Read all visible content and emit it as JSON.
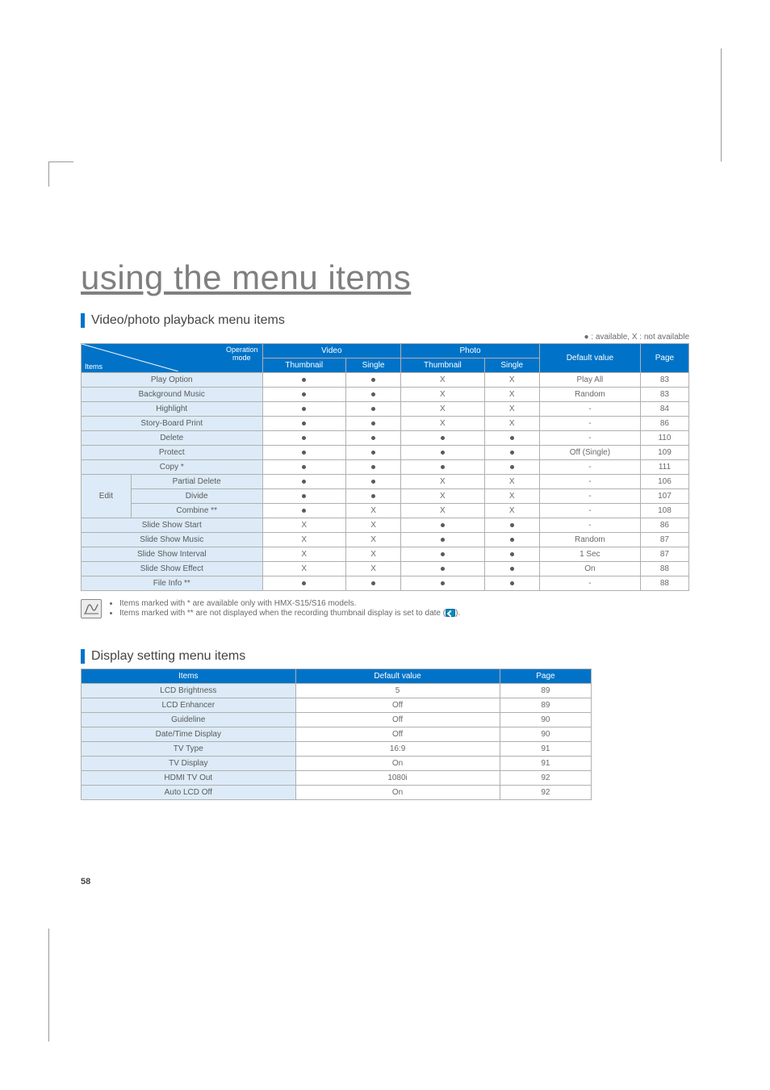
{
  "page_number": "58",
  "title": "using the menu items",
  "section1_heading": "Video/photo playback menu items",
  "legend": "● : available, X : not available",
  "t1_header": {
    "operation": "Operation",
    "mode": "mode",
    "items": "Items",
    "video": "Video",
    "photo": "Photo",
    "thumb": "Thumbnail",
    "single": "Single",
    "default": "Default value",
    "page": "Page"
  },
  "t1_rows": [
    {
      "item": "Play Option",
      "vthumb": "●",
      "vsingle": "●",
      "pthumb": "X",
      "psingle": "X",
      "def": "Play All",
      "page": "83"
    },
    {
      "item": "Background Music",
      "vthumb": "●",
      "vsingle": "●",
      "pthumb": "X",
      "psingle": "X",
      "def": "Random",
      "page": "83"
    },
    {
      "item": "Highlight",
      "vthumb": "●",
      "vsingle": "●",
      "pthumb": "X",
      "psingle": "X",
      "def": "-",
      "page": "84"
    },
    {
      "item": "Story-Board Print",
      "vthumb": "●",
      "vsingle": "●",
      "pthumb": "X",
      "psingle": "X",
      "def": "-",
      "page": "86"
    },
    {
      "item": "Delete",
      "vthumb": "●",
      "vsingle": "●",
      "pthumb": "●",
      "psingle": "●",
      "def": "-",
      "page": "110"
    },
    {
      "item": "Protect",
      "vthumb": "●",
      "vsingle": "●",
      "pthumb": "●",
      "psingle": "●",
      "def": "Off (Single)",
      "page": "109"
    },
    {
      "item": "Copy *",
      "vthumb": "●",
      "vsingle": "●",
      "pthumb": "●",
      "psingle": "●",
      "def": "-",
      "page": "111"
    }
  ],
  "edit_group_label": "Edit",
  "edit_rows": [
    {
      "item": "Partial Delete",
      "vthumb": "●",
      "vsingle": "●",
      "pthumb": "X",
      "psingle": "X",
      "def": "-",
      "page": "106"
    },
    {
      "item": "Divide",
      "vthumb": "●",
      "vsingle": "●",
      "pthumb": "X",
      "psingle": "X",
      "def": "-",
      "page": "107"
    },
    {
      "item": "Combine **",
      "vthumb": "●",
      "vsingle": "X",
      "pthumb": "X",
      "psingle": "X",
      "def": "-",
      "page": "108"
    }
  ],
  "t1_rows2": [
    {
      "item": "Slide Show Start",
      "vthumb": "X",
      "vsingle": "X",
      "pthumb": "●",
      "psingle": "●",
      "def": "-",
      "page": "86"
    },
    {
      "item": "Slide Show Music",
      "vthumb": "X",
      "vsingle": "X",
      "pthumb": "●",
      "psingle": "●",
      "def": "Random",
      "page": "87"
    },
    {
      "item": "Slide Show Interval",
      "vthumb": "X",
      "vsingle": "X",
      "pthumb": "●",
      "psingle": "●",
      "def": "1 Sec",
      "page": "87"
    },
    {
      "item": "Slide Show Effect",
      "vthumb": "X",
      "vsingle": "X",
      "pthumb": "●",
      "psingle": "●",
      "def": "On",
      "page": "88"
    },
    {
      "item": "File Info **",
      "vthumb": "●",
      "vsingle": "●",
      "pthumb": "●",
      "psingle": "●",
      "def": "-",
      "page": "88"
    }
  ],
  "notes": [
    "Items marked with * are available only with HMX-S15/S16 models.",
    "Items marked with ** are not displayed when the recording thumbnail display is set to date ("
  ],
  "note_tail": ").",
  "section2_heading": "Display setting menu items",
  "t2_header": {
    "items": "Items",
    "default": "Default value",
    "page": "Page"
  },
  "t2_rows": [
    {
      "item": "LCD Brightness",
      "def": "5",
      "page": "89"
    },
    {
      "item": "LCD Enhancer",
      "def": "Off",
      "page": "89"
    },
    {
      "item": "Guideline",
      "def": "Off",
      "page": "90"
    },
    {
      "item": "Date/Time Display",
      "def": "Off",
      "page": "90"
    },
    {
      "item": "TV Type",
      "def": "16:9",
      "page": "91"
    },
    {
      "item": "TV Display",
      "def": "On",
      "page": "91"
    },
    {
      "item": "HDMI TV Out",
      "def": "1080i",
      "page": "92"
    },
    {
      "item": "Auto LCD Off",
      "def": "On",
      "page": "92"
    }
  ]
}
